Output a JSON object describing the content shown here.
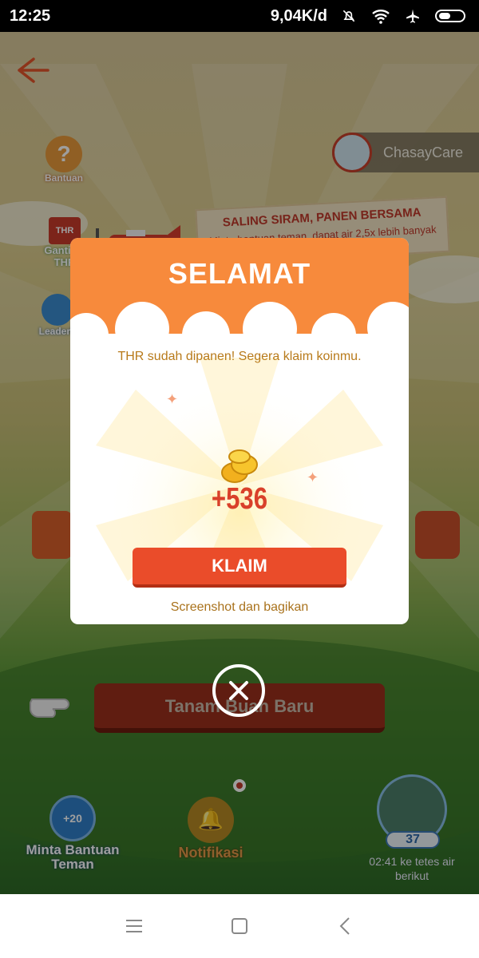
{
  "status_bar": {
    "time": "12:25",
    "network_speed": "9,04K/d",
    "icons": [
      "mute-bell-icon",
      "wifi-icon",
      "airplane-icon",
      "battery-icon"
    ]
  },
  "app": {
    "side_buttons": {
      "help": "Bantuan",
      "thr_box": "THR",
      "thr_label": "Ganti ke THR",
      "leaderboard": "Leaderb"
    },
    "user": {
      "name": "ChasayCare"
    },
    "banner": {
      "title": "SALING SIRAM, PANEN BERSAMA",
      "subtitle": "Minta bantuan teman, dapat air 2,5x lebih banyak"
    },
    "plant_button": "Tanam Buah Baru",
    "bottom": {
      "ask_help_badge": "+20",
      "ask_help_label": "Minta Bantuan Teman",
      "notification_label": "Notifikasi",
      "water_count": "37",
      "water_timer": "02:41 ke tetes air berikut"
    }
  },
  "modal": {
    "title": "SELAMAT",
    "message": "THR sudah dipanen! Segera klaim koinmu.",
    "amount": "+536",
    "claim_label": "KLAIM",
    "share_label": "Screenshot dan bagikan"
  },
  "colors": {
    "modal_header": "#f78a3c",
    "claim_button": "#ea4c2a",
    "amount_text": "#d9402a",
    "message_text": "#b87a1a"
  }
}
